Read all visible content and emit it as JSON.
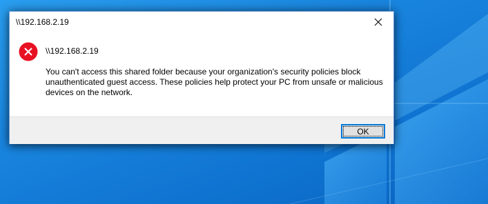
{
  "dialog": {
    "title": "\\\\192.168.2.19",
    "heading": "\\\\192.168.2.19",
    "message": "You can't access this shared folder because your organization's security policies block unauthenticated guest access. These policies help protect your PC from unsafe or malicious devices on the network.",
    "ok_label": "OK",
    "icon": "error-icon",
    "close_icon": "close-icon"
  },
  "colors": {
    "desktop_accent": "#0f74d1",
    "error_red": "#e81123",
    "button_focus": "#0078d7"
  }
}
